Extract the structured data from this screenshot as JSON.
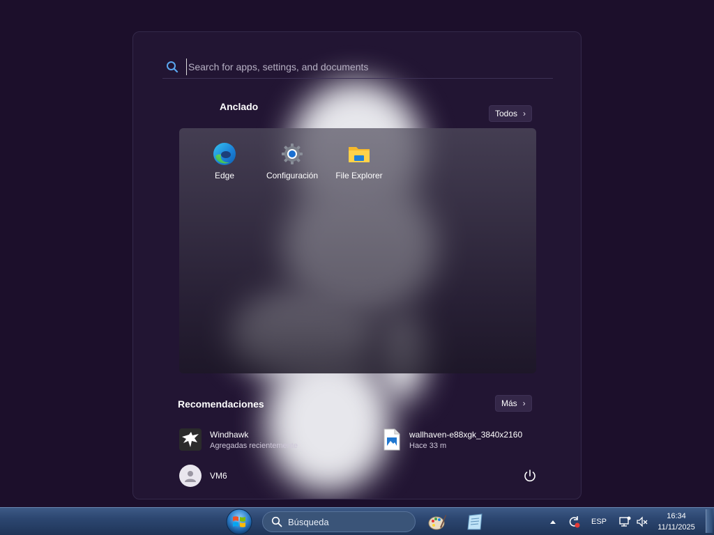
{
  "start_menu": {
    "search": {
      "placeholder": "Search for apps, settings, and documents",
      "value": ""
    },
    "pinned": {
      "title": "Anclado",
      "all_button": "Todos",
      "apps": [
        {
          "label": "Edge",
          "icon": "edge-icon"
        },
        {
          "label": "Configuración",
          "icon": "gear-icon"
        },
        {
          "label": "File Explorer",
          "icon": "folder-icon"
        }
      ]
    },
    "recommended": {
      "title": "Recomendaciones",
      "more_button": "Más",
      "items": [
        {
          "title": "Windhawk",
          "subtitle": "Agregadas recientemente",
          "icon": "windhawk-icon"
        },
        {
          "title": "wallhaven-e88xgk_3840x2160",
          "subtitle": "Hace 33 m",
          "icon": "image-file-icon"
        }
      ]
    },
    "user": {
      "name": "VM6"
    }
  },
  "taskbar": {
    "search_label": "Búsqueda",
    "language": "ESP",
    "time": "16:34",
    "date": "11/11/2025"
  },
  "colors": {
    "desktop_bg": "#1c0f2b",
    "menu_bg": "#221533",
    "taskbar": "#2c4670",
    "accent_blue": "#3a8ee6"
  }
}
